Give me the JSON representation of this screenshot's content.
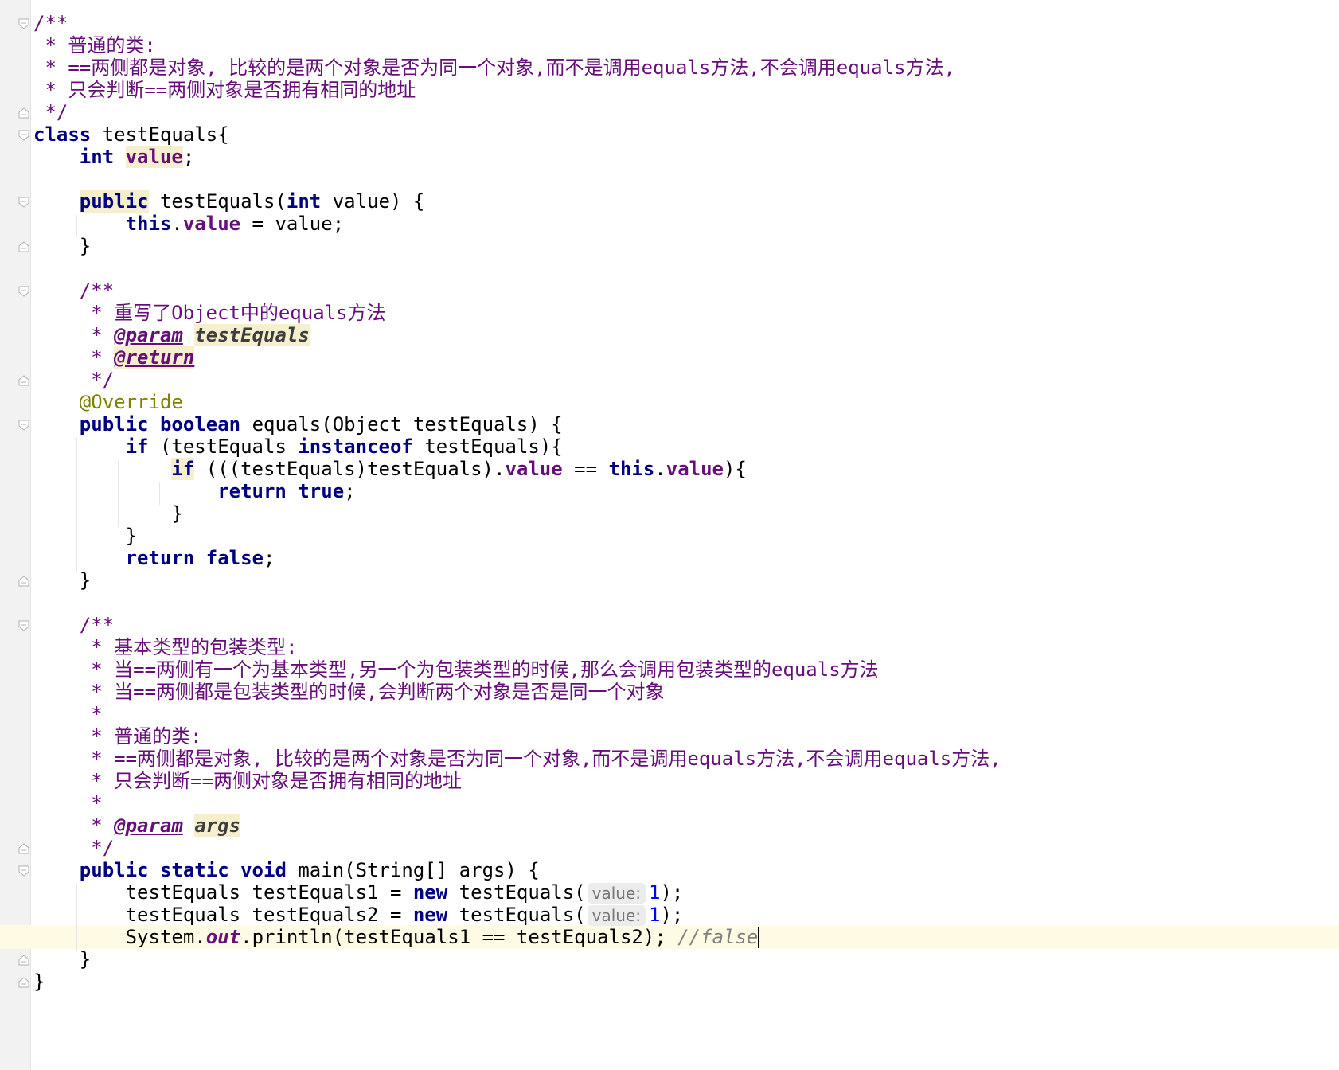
{
  "editor": {
    "lines": [
      "/**",
      " * 普通的类:",
      " * ==两侧都是对象, 比较的是两个对象是否为同一个对象,而不是调用equals方法,不会调用equals方法,",
      " * 只会判断==两侧对象是否拥有相同的地址",
      " */",
      "class testEquals{",
      "    int value;",
      "",
      "    public testEquals(int value) {",
      "        this.value = value;",
      "    }",
      "",
      "    /**",
      "     * 重写了Object中的equals方法",
      "     * @param testEquals",
      "     * @return",
      "     */",
      "    @Override",
      "    public boolean equals(Object testEquals) {",
      "        if (testEquals instanceof testEquals){",
      "            if (((testEquals)testEquals).value == this.value){",
      "                return true;",
      "            }",
      "        }",
      "        return false;",
      "    }",
      "",
      "    /**",
      "     * 基本类型的包装类型:",
      "     * 当==两侧有一个为基本类型,另一个为包装类型的时候,那么会调用包装类型的equals方法",
      "     * 当==两侧都是包装类型的时候,会判断两个对象是否是同一个对象",
      "     *",
      "     * 普通的类:",
      "     * ==两侧都是对象, 比较的是两个对象是否为同一个对象,而不是调用equals方法,不会调用equals方法,",
      "     * 只会判断==两侧对象是否拥有相同的地址",
      "     *",
      "     * @param args",
      "     */",
      "    public static void main(String[] args) {",
      "        testEquals testEquals1 = new testEquals( value: 1);",
      "        testEquals testEquals2 = new testEquals( value: 1);",
      "        System.out.println(testEquals1 == testEquals2); //false",
      "    }",
      "}"
    ],
    "tokens": {
      "class_kw": "class",
      "int_kw": "int",
      "public_kw": "public",
      "this_kw": "this",
      "boolean_kw": "boolean",
      "if_kw": "if",
      "instanceof_kw": "instanceof",
      "return_kw": "return",
      "true_kw": "true",
      "false_kw": "false",
      "static_kw": "static",
      "void_kw": "void",
      "new_kw": "new",
      "class_name": "testEquals",
      "field_value": "value",
      "param_value": "value",
      "object_type": "Object",
      "string_type": "String",
      "param_testEquals": "testEquals",
      "equals_name": "equals",
      "main_name": "main",
      "args_name": "args",
      "annotation_override": "@Override",
      "doc_param_tag": "@param",
      "doc_return_tag": "@return",
      "var1": "testEquals1",
      "var2": "testEquals2",
      "system": "System",
      "out": "out",
      "println": "println",
      "hint_value": "value:",
      "num_one": "1",
      "comment_false": "//false"
    },
    "doc_text": {
      "open": "/**",
      "close": "*/",
      "star": "*",
      "plain_class": "普通的类:",
      "eq_line": "==两侧都是对象, 比较的是两个对象是否为同一个对象,而不是调用equals方法,不会调用equals方法,",
      "addr_line": "只会判断==两侧对象是否拥有相同的地址",
      "override_desc": "重写了Object中的equals方法",
      "wrapper_title": "基本类型的包装类型:",
      "wrapper_line1": "当==两侧有一个为基本类型,另一个为包装类型的时候,那么会调用包装类型的equals方法",
      "wrapper_line2": "当==两侧都是包装类型的时候,会判断两个对象是否是同一个对象"
    },
    "colors": {
      "keyword": "#000080",
      "field": "#660e7a",
      "doc_comment": "#660e7a",
      "annotation": "#808000",
      "line_comment": "#808080",
      "number": "#0000ff",
      "caret_row": "#fffae3",
      "identifier_highlight": "#f6efcd",
      "gutter": "#f2f2f2"
    }
  }
}
